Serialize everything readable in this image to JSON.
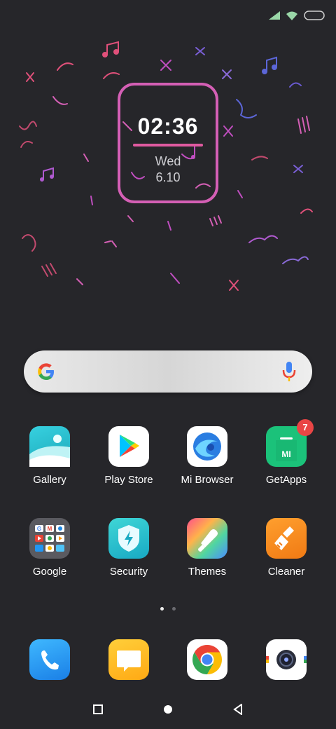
{
  "status_bar": {
    "signal": "signal-icon",
    "wifi": "wifi-icon",
    "battery": "battery-icon"
  },
  "clock": {
    "time": "02:36",
    "day": "Wed",
    "date": "6.10"
  },
  "search_bar": {
    "logo": "google-g-icon",
    "mic": "microphone-icon"
  },
  "apps_row1": [
    {
      "label": "Gallery",
      "icon": "gallery-icon"
    },
    {
      "label": "Play Store",
      "icon": "play-store-icon"
    },
    {
      "label": "Mi Browser",
      "icon": "mi-browser-icon"
    },
    {
      "label": "GetApps",
      "icon": "getapps-icon",
      "badge": "7"
    }
  ],
  "apps_row2": [
    {
      "label": "Google",
      "icon": "google-folder-icon"
    },
    {
      "label": "Security",
      "icon": "security-icon"
    },
    {
      "label": "Themes",
      "icon": "themes-icon"
    },
    {
      "label": "Cleaner",
      "icon": "cleaner-icon"
    }
  ],
  "dock": [
    {
      "icon": "phone-icon"
    },
    {
      "icon": "messages-icon"
    },
    {
      "icon": "chrome-icon"
    },
    {
      "icon": "camera-icon"
    }
  ],
  "page_indicator": {
    "count": 2,
    "active": 0
  },
  "nav_bar": {
    "recents": "recents-icon",
    "home": "home-icon",
    "back": "back-icon"
  },
  "colors": {
    "background": "#26262a",
    "accent": "#d45fb5"
  }
}
